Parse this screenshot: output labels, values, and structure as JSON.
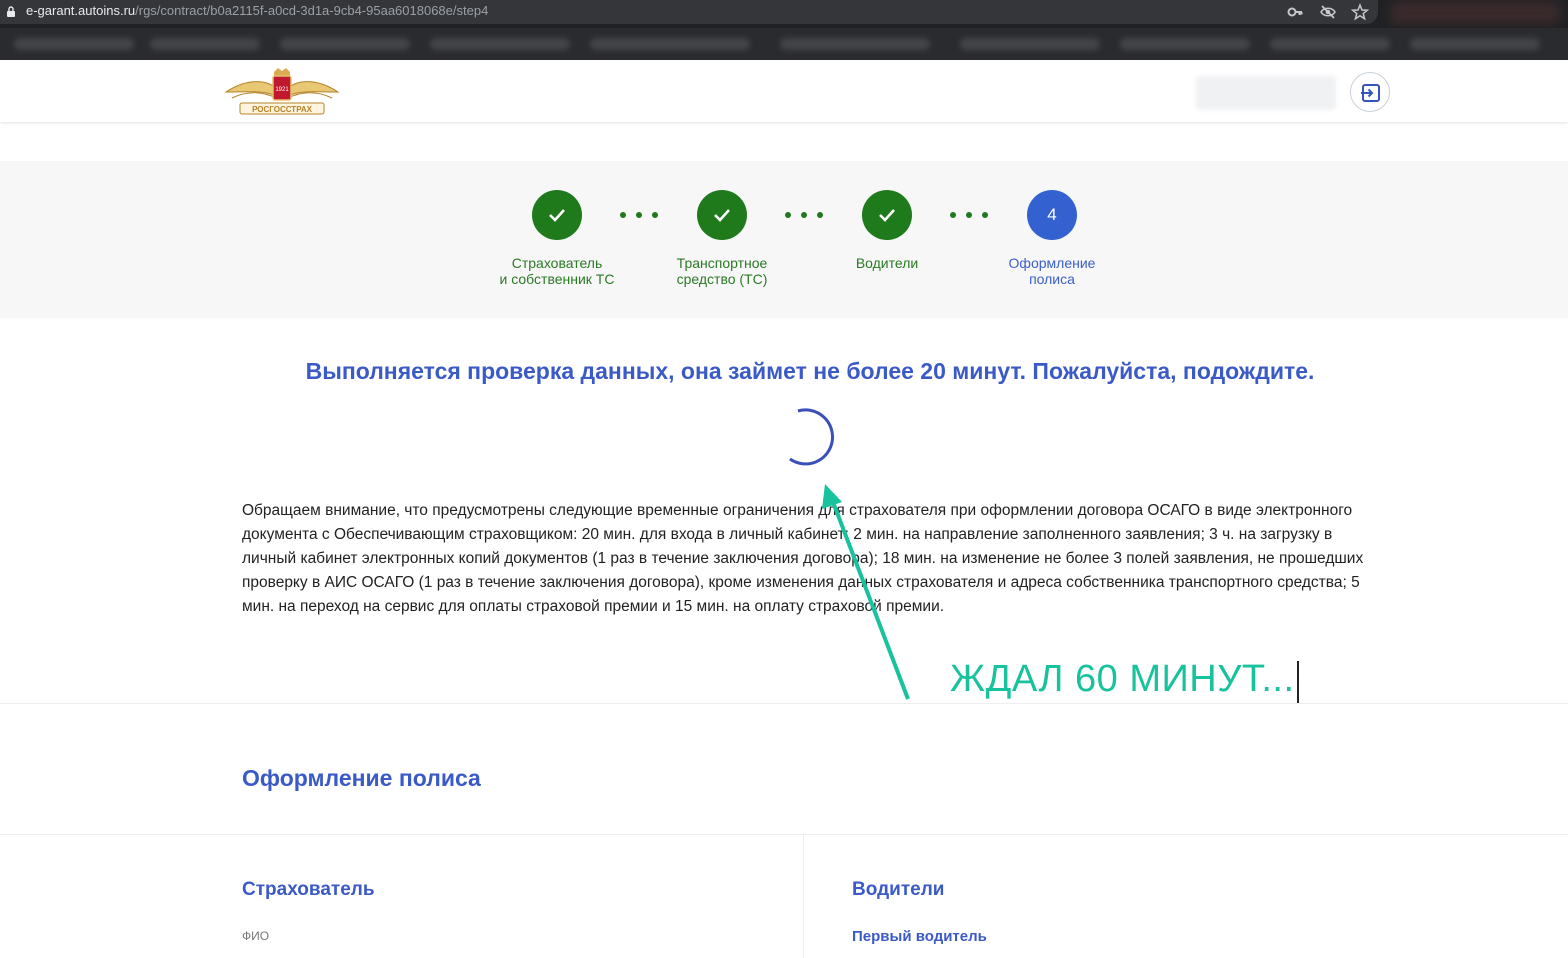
{
  "browser": {
    "url_host": "e-garant.autoins.ru",
    "url_path": "/rgs/contract/b0a2115f-a0cd-3d1a-9cb4-95aa6018068e/step4",
    "icons": [
      "lock-icon",
      "key-icon",
      "eye-off-icon",
      "star-icon"
    ]
  },
  "header": {
    "logo_year": "1921",
    "logo_text": "РОСГОССТРАХ",
    "logout_icon": "logout-icon"
  },
  "stepper": {
    "steps": [
      {
        "label": "Страхователь\nи собственник ТС",
        "state": "done"
      },
      {
        "label": "Транспортное\nсредство (ТС)",
        "state": "done"
      },
      {
        "label": "Водители",
        "state": "done"
      },
      {
        "label": "Оформление\nполиса",
        "state": "active",
        "number": "4"
      }
    ],
    "colors": {
      "done": "#1e7a1b",
      "active": "#3361d0"
    }
  },
  "main": {
    "check_title": "Выполняется проверка данных, она займет не более 20 минут. Пожалуйста, подождите.",
    "notice": "Обращаем внимание, что предусмотрены следующие временные ограничения для страхователя при оформлении договора ОСАГО в виде электронного документа с Обеспечивающим страховщиком: 20 мин. для входа в личный кабинет; 2 мин. на направление заполненного заявления; 3 ч. на загрузку в личный кабинет электронных копий документов (1 раз в течение заключения договора); 18 мин. на изменение не более 3 полей заявления, не прошедших проверку в АИС ОСАГО (1 раз в течение заключения договора), кроме изменения данных страхователя и адреса собственника транспортного средства; 5 мин. на переход на сервис для оплаты страховой премии и 15 мин. на оплату страховой премии."
  },
  "annotation": {
    "text": "ЖДАЛ 60 МИНУТ...",
    "color": "#18c29c"
  },
  "policy": {
    "section_title": "Оформление полиса",
    "insurer_title": "Страхователь",
    "insurer_field_label": "ФИО",
    "drivers_title": "Водители",
    "first_driver_link": "Первый водитель"
  }
}
